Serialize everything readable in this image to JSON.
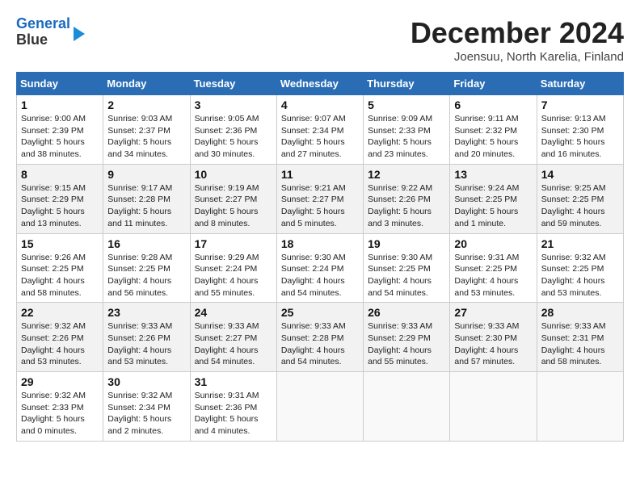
{
  "header": {
    "logo_line1": "General",
    "logo_line2": "Blue",
    "month": "December 2024",
    "location": "Joensuu, North Karelia, Finland"
  },
  "days_of_week": [
    "Sunday",
    "Monday",
    "Tuesday",
    "Wednesday",
    "Thursday",
    "Friday",
    "Saturday"
  ],
  "weeks": [
    [
      {
        "day": 1,
        "info": "Sunrise: 9:00 AM\nSunset: 2:39 PM\nDaylight: 5 hours\nand 38 minutes."
      },
      {
        "day": 2,
        "info": "Sunrise: 9:03 AM\nSunset: 2:37 PM\nDaylight: 5 hours\nand 34 minutes."
      },
      {
        "day": 3,
        "info": "Sunrise: 9:05 AM\nSunset: 2:36 PM\nDaylight: 5 hours\nand 30 minutes."
      },
      {
        "day": 4,
        "info": "Sunrise: 9:07 AM\nSunset: 2:34 PM\nDaylight: 5 hours\nand 27 minutes."
      },
      {
        "day": 5,
        "info": "Sunrise: 9:09 AM\nSunset: 2:33 PM\nDaylight: 5 hours\nand 23 minutes."
      },
      {
        "day": 6,
        "info": "Sunrise: 9:11 AM\nSunset: 2:32 PM\nDaylight: 5 hours\nand 20 minutes."
      },
      {
        "day": 7,
        "info": "Sunrise: 9:13 AM\nSunset: 2:30 PM\nDaylight: 5 hours\nand 16 minutes."
      }
    ],
    [
      {
        "day": 8,
        "info": "Sunrise: 9:15 AM\nSunset: 2:29 PM\nDaylight: 5 hours\nand 13 minutes."
      },
      {
        "day": 9,
        "info": "Sunrise: 9:17 AM\nSunset: 2:28 PM\nDaylight: 5 hours\nand 11 minutes."
      },
      {
        "day": 10,
        "info": "Sunrise: 9:19 AM\nSunset: 2:27 PM\nDaylight: 5 hours\nand 8 minutes."
      },
      {
        "day": 11,
        "info": "Sunrise: 9:21 AM\nSunset: 2:27 PM\nDaylight: 5 hours\nand 5 minutes."
      },
      {
        "day": 12,
        "info": "Sunrise: 9:22 AM\nSunset: 2:26 PM\nDaylight: 5 hours\nand 3 minutes."
      },
      {
        "day": 13,
        "info": "Sunrise: 9:24 AM\nSunset: 2:25 PM\nDaylight: 5 hours\nand 1 minute."
      },
      {
        "day": 14,
        "info": "Sunrise: 9:25 AM\nSunset: 2:25 PM\nDaylight: 4 hours\nand 59 minutes."
      }
    ],
    [
      {
        "day": 15,
        "info": "Sunrise: 9:26 AM\nSunset: 2:25 PM\nDaylight: 4 hours\nand 58 minutes."
      },
      {
        "day": 16,
        "info": "Sunrise: 9:28 AM\nSunset: 2:25 PM\nDaylight: 4 hours\nand 56 minutes."
      },
      {
        "day": 17,
        "info": "Sunrise: 9:29 AM\nSunset: 2:24 PM\nDaylight: 4 hours\nand 55 minutes."
      },
      {
        "day": 18,
        "info": "Sunrise: 9:30 AM\nSunset: 2:24 PM\nDaylight: 4 hours\nand 54 minutes."
      },
      {
        "day": 19,
        "info": "Sunrise: 9:30 AM\nSunset: 2:25 PM\nDaylight: 4 hours\nand 54 minutes."
      },
      {
        "day": 20,
        "info": "Sunrise: 9:31 AM\nSunset: 2:25 PM\nDaylight: 4 hours\nand 53 minutes."
      },
      {
        "day": 21,
        "info": "Sunrise: 9:32 AM\nSunset: 2:25 PM\nDaylight: 4 hours\nand 53 minutes."
      }
    ],
    [
      {
        "day": 22,
        "info": "Sunrise: 9:32 AM\nSunset: 2:26 PM\nDaylight: 4 hours\nand 53 minutes."
      },
      {
        "day": 23,
        "info": "Sunrise: 9:33 AM\nSunset: 2:26 PM\nDaylight: 4 hours\nand 53 minutes."
      },
      {
        "day": 24,
        "info": "Sunrise: 9:33 AM\nSunset: 2:27 PM\nDaylight: 4 hours\nand 54 minutes."
      },
      {
        "day": 25,
        "info": "Sunrise: 9:33 AM\nSunset: 2:28 PM\nDaylight: 4 hours\nand 54 minutes."
      },
      {
        "day": 26,
        "info": "Sunrise: 9:33 AM\nSunset: 2:29 PM\nDaylight: 4 hours\nand 55 minutes."
      },
      {
        "day": 27,
        "info": "Sunrise: 9:33 AM\nSunset: 2:30 PM\nDaylight: 4 hours\nand 57 minutes."
      },
      {
        "day": 28,
        "info": "Sunrise: 9:33 AM\nSunset: 2:31 PM\nDaylight: 4 hours\nand 58 minutes."
      }
    ],
    [
      {
        "day": 29,
        "info": "Sunrise: 9:32 AM\nSunset: 2:33 PM\nDaylight: 5 hours\nand 0 minutes."
      },
      {
        "day": 30,
        "info": "Sunrise: 9:32 AM\nSunset: 2:34 PM\nDaylight: 5 hours\nand 2 minutes."
      },
      {
        "day": 31,
        "info": "Sunrise: 9:31 AM\nSunset: 2:36 PM\nDaylight: 5 hours\nand 4 minutes."
      },
      null,
      null,
      null,
      null
    ]
  ]
}
